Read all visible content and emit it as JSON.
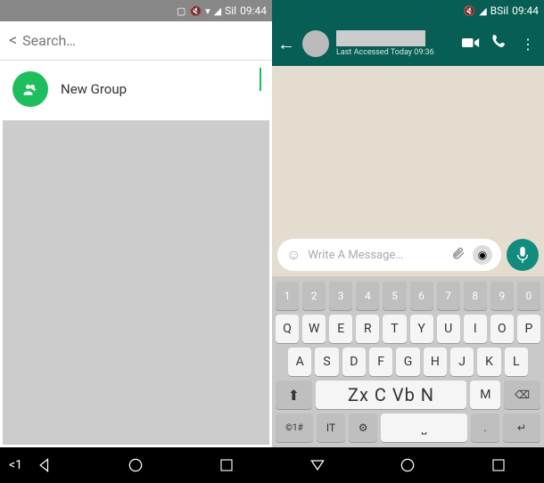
{
  "status": {
    "time": "09:44",
    "sig_left": "Sil",
    "sig_right": "BSil"
  },
  "left": {
    "search_placeholder": "Search…",
    "new_group": "New Group"
  },
  "right": {
    "last_access": "Last Accessed Today 09:36",
    "msg_placeholder": "Write A Message…"
  },
  "keyboard": {
    "nums": [
      "1",
      "2",
      "3",
      "4",
      "5",
      "6",
      "7",
      "8",
      "9",
      "0"
    ],
    "r1": [
      "Q",
      "W",
      "E",
      "R",
      "T",
      "Y",
      "U",
      "I",
      "O",
      "P"
    ],
    "r2": [
      "A",
      "S",
      "D",
      "F",
      "G",
      "H",
      "J",
      "K",
      "L"
    ],
    "r3_big": "Zx C Vb N",
    "r3_m": "M",
    "shift": "⬆",
    "back": "⌫",
    "sym": "©1#",
    "lang": "IT",
    "gear": "⚙",
    "space": "⎵",
    "dot": ".",
    "enter": "↵"
  },
  "nav": {
    "count": "<1"
  }
}
